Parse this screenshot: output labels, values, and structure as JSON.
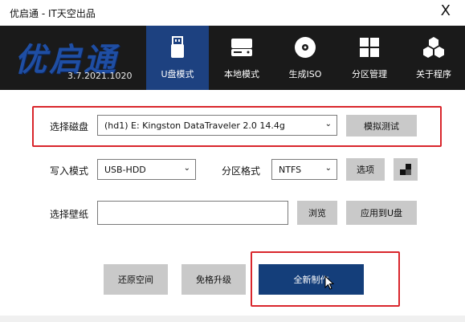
{
  "window": {
    "title": "优启通 - IT天空出品",
    "close_glyph": "X"
  },
  "header": {
    "logo_text": "优启通",
    "version": "3.7.2021.1020",
    "accent_color": "#1d4180",
    "tabs": [
      {
        "label": "U盘模式",
        "icon": "usb-drive-icon",
        "active": true
      },
      {
        "label": "本地模式",
        "icon": "hard-disk-icon",
        "active": false
      },
      {
        "label": "生成ISO",
        "icon": "disc-icon",
        "active": false
      },
      {
        "label": "分区管理",
        "icon": "partition-grid-icon",
        "active": false
      },
      {
        "label": "关于程序",
        "icon": "hexagon-cluster-icon",
        "active": false
      }
    ]
  },
  "form": {
    "disk": {
      "label": "选择磁盘",
      "value": "(hd1) E: Kingston DataTraveler 2.0 14.4g",
      "test_button": "模拟测试"
    },
    "mode": {
      "label": "写入模式",
      "value": "USB-HDD"
    },
    "partition": {
      "label": "分区格式",
      "value": "NTFS",
      "options_button": "选项"
    },
    "wallpaper": {
      "label": "选择壁纸",
      "value": "",
      "browse_button": "浏览",
      "apply_button": "应用到U盘"
    }
  },
  "actions": {
    "restore_space": "还原空间",
    "upgrade": "免格升级",
    "full_create": "全新制作"
  }
}
